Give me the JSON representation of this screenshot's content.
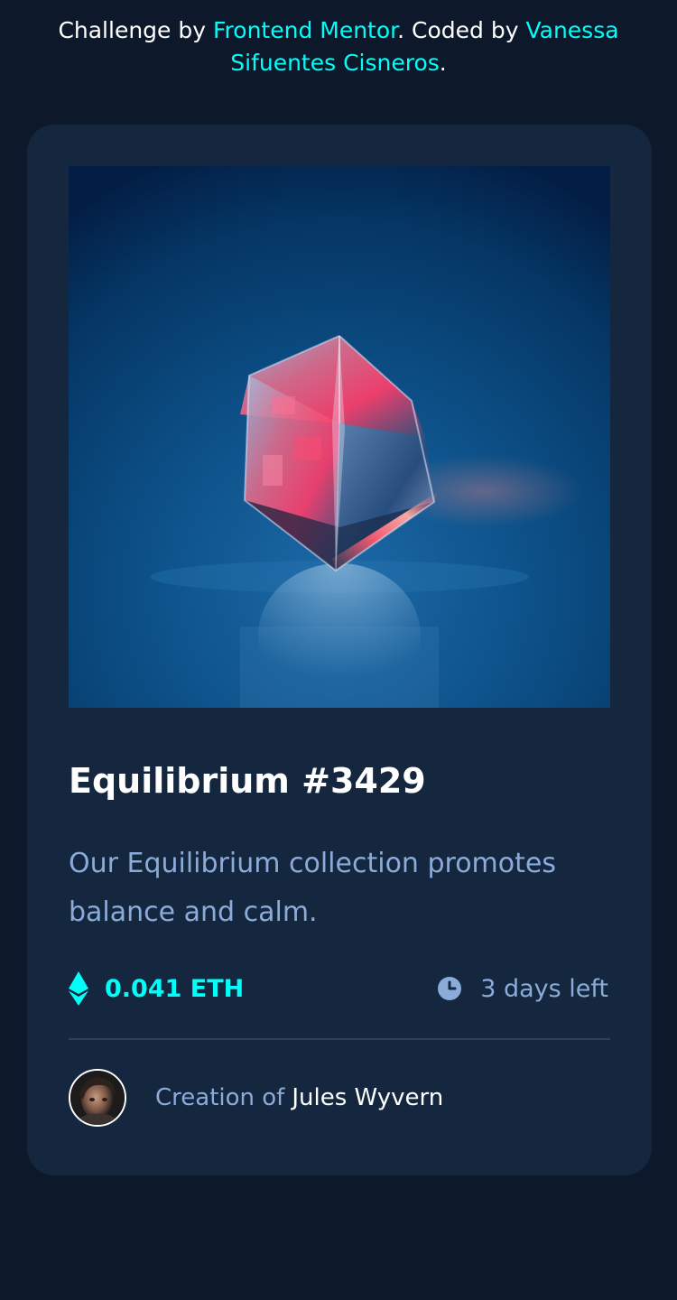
{
  "attribution": {
    "prefix": "Challenge by ",
    "challenge_link": "Frontend Mentor",
    "middle": ". Coded by ",
    "author_link": "Vanessa Sifuentes Cisneros",
    "suffix": "."
  },
  "card": {
    "title": "Equilibrium #3429",
    "description": "Our Equilibrium collection promotes balance and calm.",
    "price": "0.041 ETH",
    "time_left": "3 days left",
    "creation_label": "Creation of",
    "creator_name": "Jules Wyvern"
  },
  "icons": {
    "ethereum": "ethereum-icon",
    "clock": "clock-icon"
  },
  "colors": {
    "page_bg": "#0d192b",
    "card_bg": "#15263f",
    "accent_cyan": "#00fff8",
    "soft_blue": "#8bacd9",
    "divider": "#2e405a",
    "white": "#ffffff"
  }
}
